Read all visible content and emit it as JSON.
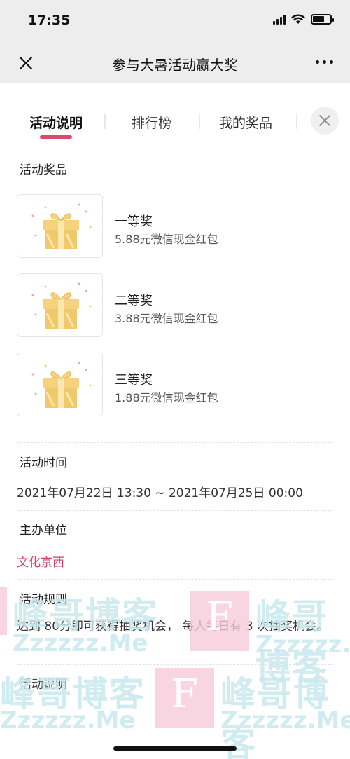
{
  "status_bar": {
    "time": "17:35"
  },
  "nav": {
    "title": "参与大暑活动赢大奖"
  },
  "tabs": [
    {
      "label": "活动说明",
      "active": true
    },
    {
      "label": "排行榜",
      "active": false
    },
    {
      "label": "我的奖品",
      "active": false
    }
  ],
  "prizes_section": {
    "heading": "活动奖品",
    "items": [
      {
        "name": "一等奖",
        "desc": "5.88元微信现金红包"
      },
      {
        "name": "二等奖",
        "desc": "3.88元微信现金红包"
      },
      {
        "name": "三等奖",
        "desc": "1.88元微信现金红包"
      }
    ]
  },
  "time_section": {
    "heading": "活动时间",
    "value": "2021年07月22日 13:30 ~ 2021年07月25日 00:00"
  },
  "organizer_section": {
    "heading": "主办单位",
    "value": "文化京西"
  },
  "rules_section": {
    "heading": "活动规则",
    "value": "达到 80分即可获得抽奖机会， 每人每日有 3 次抽奖机会。"
  },
  "description_section": {
    "heading": "活动说明"
  },
  "watermark": {
    "brand": "峰哥博客",
    "domain": "Zzzzzz.Me",
    "letter": "F"
  },
  "colors": {
    "accent": "#d94b6b",
    "organizer": "#c9456a",
    "gift": "#f2c96a"
  }
}
